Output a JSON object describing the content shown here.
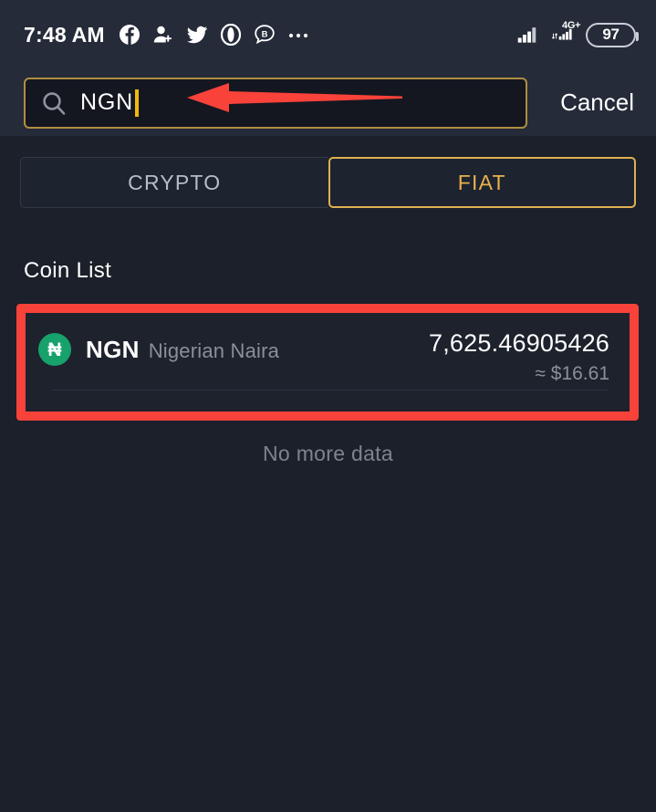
{
  "status_bar": {
    "clock": "7:48 AM",
    "notification_icons": [
      {
        "name": "facebook-icon",
        "label": "Facebook"
      },
      {
        "name": "person-add-icon",
        "label": "Contact request"
      },
      {
        "name": "twitter-icon",
        "label": "Twitter"
      },
      {
        "name": "opera-icon",
        "label": "Opera"
      },
      {
        "name": "binance-chat-icon",
        "label": "Binance"
      },
      {
        "name": "more-notifications-icon",
        "label": "More"
      }
    ],
    "network_label": "4G+",
    "battery_level": "97"
  },
  "search": {
    "value": "NGN",
    "placeholder": "Search",
    "cancel_label": "Cancel",
    "caret_color": "#f0b90b",
    "border_color": "#b08d3f"
  },
  "tabs": [
    {
      "label": "CRYPTO",
      "active": false
    },
    {
      "label": "FIAT",
      "active": true
    }
  ],
  "coin_list": {
    "title": "Coin List",
    "rows": [
      {
        "badge_symbol": "₦",
        "badge_color": "#17a16b",
        "symbol": "NGN",
        "name": "Nigerian Naira",
        "amount": "7,625.46905426",
        "fiat_value": "≈ $16.61"
      }
    ],
    "footer": "No more data"
  },
  "annotations": {
    "arrow_color": "#f9423a",
    "highlight_color": "#f9423a"
  }
}
